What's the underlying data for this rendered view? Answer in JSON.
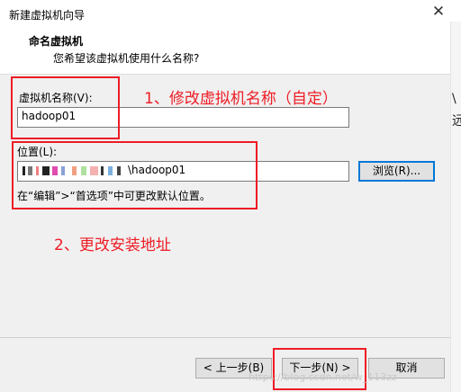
{
  "window": {
    "title": "新建虚拟机向导",
    "close_glyph": "✕"
  },
  "header": {
    "title": "命名虚拟机",
    "subtitle": "您希望该虚拟机使用什么名称?"
  },
  "name_section": {
    "label": "虚拟机名称(V):",
    "value": "hadoop01"
  },
  "location_section": {
    "label": "位置(L):",
    "value_suffix": "\\hadoop01",
    "browse_label": "浏览(R)...",
    "hint": "在“编辑”>“首选项”中可更改默认位置。"
  },
  "buttons": {
    "back": "< 上一步(B)",
    "next": "下一步(N) >",
    "cancel": "取消"
  },
  "annotations": {
    "note1": "1、修改虚拟机名称（自定）",
    "note2": "2、更改安装地址",
    "color": "#ee1c25"
  },
  "side_fragments": [
    "\\",
    "远"
  ],
  "watermark": "https://blog.csdn.net/w_113zz"
}
